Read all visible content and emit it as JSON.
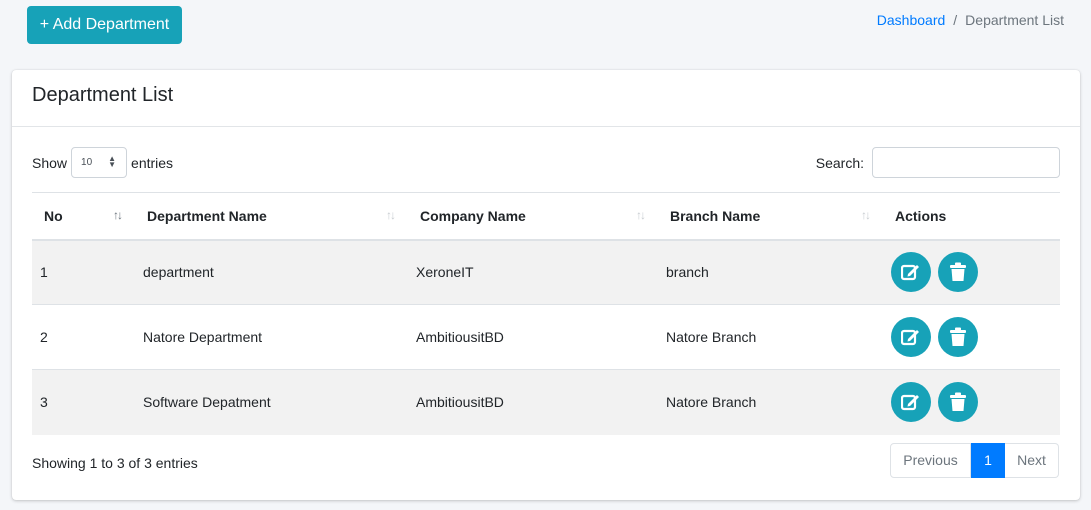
{
  "header": {
    "add_button_label": "+ Add Department",
    "breadcrumb": {
      "home": "Dashboard",
      "separator": "/",
      "current": "Department List"
    }
  },
  "card": {
    "title": "Department List"
  },
  "controls": {
    "show_label": "Show",
    "page_size": "10",
    "entries_label": "entries",
    "search_label": "Search:",
    "search_value": ""
  },
  "table": {
    "columns": [
      "No",
      "Department Name",
      "Company Name",
      "Branch Name",
      "Actions"
    ],
    "rows": [
      {
        "no": "1",
        "department": "department",
        "company": "XeroneIT",
        "branch": "branch"
      },
      {
        "no": "2",
        "department": "Natore Department",
        "company": "AmbitiousitBD",
        "branch": "Natore Branch"
      },
      {
        "no": "3",
        "department": "Software Depatment",
        "company": "AmbitiousitBD",
        "branch": "Natore Branch"
      }
    ]
  },
  "footer": {
    "info": "Showing 1 to 3 of 3 entries",
    "pagination": {
      "previous": "Previous",
      "current": "1",
      "next": "Next"
    }
  },
  "colors": {
    "accent": "#17a2b8",
    "primary": "#007bff"
  },
  "icons": {
    "edit": "edit-icon",
    "delete": "trash-icon",
    "sort": "sort-icon"
  }
}
